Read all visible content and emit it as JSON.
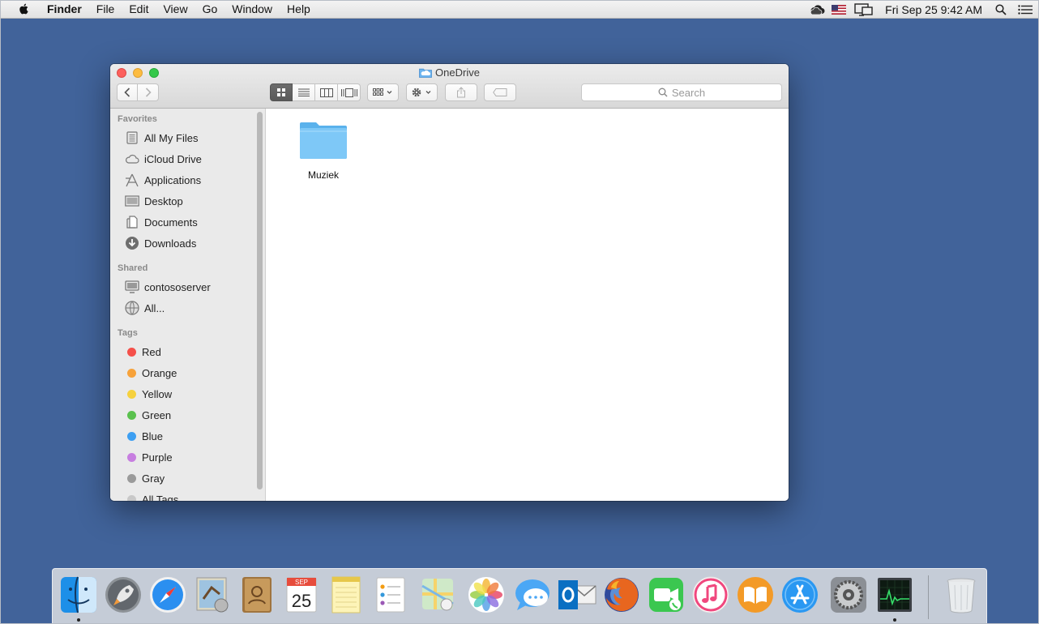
{
  "menubar": {
    "apple_icon": "apple-icon",
    "items": [
      "Finder",
      "File",
      "Edit",
      "View",
      "Go",
      "Window",
      "Help"
    ],
    "clock": "Fri Sep 25  9:42 AM",
    "status_icons": [
      "onedrive-cloud-icon",
      "us-flag-icon",
      "airplay-display-icon",
      "spotlight-search-icon",
      "notification-center-icon"
    ]
  },
  "window": {
    "title": "OneDrive",
    "search_placeholder": "Search",
    "view_modes": [
      "icon-view",
      "list-view",
      "column-view",
      "cover-flow-view"
    ]
  },
  "sidebar": {
    "favorites_heading": "Favorites",
    "favorites": [
      {
        "label": "All My Files",
        "icon": "all-my-files-icon"
      },
      {
        "label": "iCloud Drive",
        "icon": "icloud-icon"
      },
      {
        "label": "Applications",
        "icon": "applications-icon"
      },
      {
        "label": "Desktop",
        "icon": "desktop-icon"
      },
      {
        "label": "Documents",
        "icon": "documents-icon"
      },
      {
        "label": "Downloads",
        "icon": "downloads-icon"
      }
    ],
    "shared_heading": "Shared",
    "shared": [
      {
        "label": "contososerver",
        "icon": "server-icon"
      },
      {
        "label": "All...",
        "icon": "network-globe-icon"
      }
    ],
    "tags_heading": "Tags",
    "tags": [
      {
        "label": "Red",
        "color": "#f5504a"
      },
      {
        "label": "Orange",
        "color": "#f7a23a"
      },
      {
        "label": "Yellow",
        "color": "#f6d13e"
      },
      {
        "label": "Green",
        "color": "#5ac14e"
      },
      {
        "label": "Blue",
        "color": "#3d9ff2"
      },
      {
        "label": "Purple",
        "color": "#c77ee0"
      },
      {
        "label": "Gray",
        "color": "#9a9a9a"
      },
      {
        "label": "All Tags...",
        "color": "#c8c8c8"
      }
    ]
  },
  "content": {
    "items": [
      {
        "label": "Muziek",
        "type": "folder",
        "icon": "folder-icon"
      }
    ]
  },
  "dock": {
    "calendar_month": "SEP",
    "calendar_day": "25",
    "apps": [
      "Finder",
      "Launchpad",
      "Safari",
      "Mail",
      "Contacts",
      "Calendar",
      "Notes",
      "Reminders",
      "Maps",
      "Photos",
      "Messages",
      "Outlook",
      "Firefox",
      "FaceTime",
      "iTunes",
      "iBooks",
      "App Store",
      "System Preferences",
      "Activity Monitor",
      "Trash"
    ],
    "running": [
      "Finder",
      "Activity Monitor"
    ]
  }
}
